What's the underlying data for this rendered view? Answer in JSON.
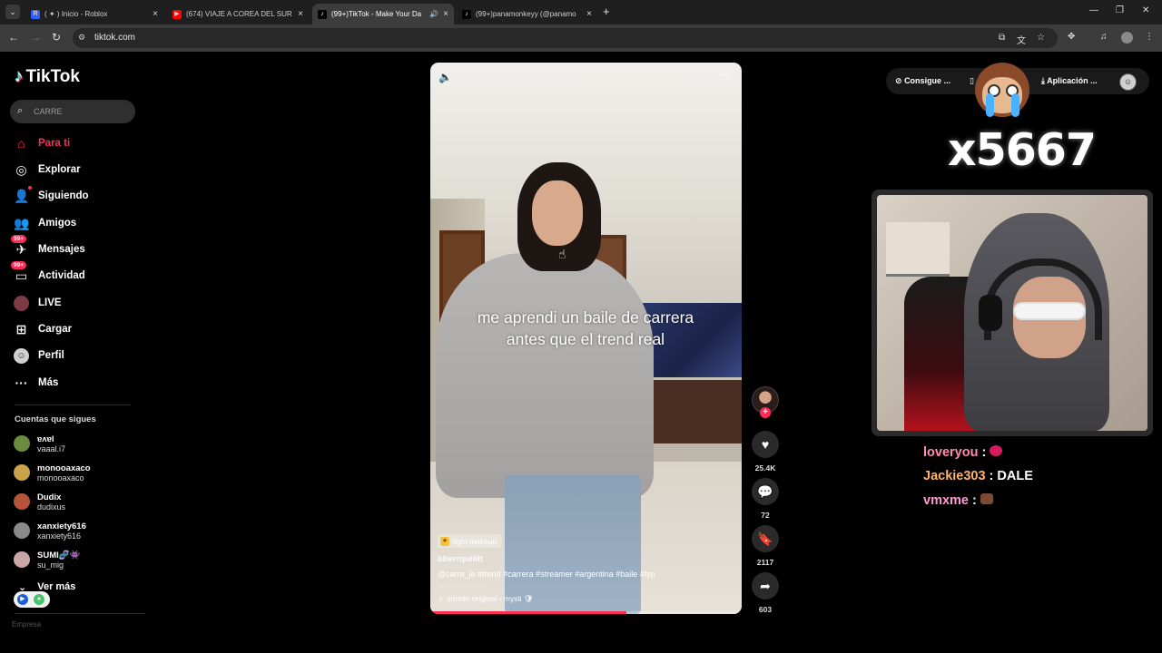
{
  "browser": {
    "tabs": [
      {
        "title": "( ✦ ) Inicio - Roblox",
        "favicon_color": "#335fff",
        "favicon_glyph": "R",
        "active": false
      },
      {
        "title": "(674) VIAJE A COREA DEL SUR (",
        "favicon_color": "#ff0000",
        "favicon_glyph": "▶",
        "active": false
      },
      {
        "title": "(99+)TikTok - Make Your Da",
        "favicon_color": "#000000",
        "favicon_glyph": "♪",
        "active": true,
        "audio": true
      },
      {
        "title": "(99+)panamonkeyy (@panamo",
        "favicon_color": "#000000",
        "favicon_glyph": "♪",
        "active": false
      }
    ],
    "url": "tiktok.com"
  },
  "tiktok": {
    "brand": "TikTok",
    "search_value": "CARRE",
    "nav": [
      {
        "label": "Para ti",
        "icon": "home-icon",
        "active": true
      },
      {
        "label": "Explorar",
        "icon": "compass-icon"
      },
      {
        "label": "Siguiendo",
        "icon": "following-icon"
      },
      {
        "label": "Amigos",
        "icon": "friends-icon"
      },
      {
        "label": "Mensajes",
        "icon": "messages-icon",
        "badge": "99+"
      },
      {
        "label": "Actividad",
        "icon": "activity-icon",
        "badge": "99+"
      },
      {
        "label": "LIVE",
        "icon": "live-icon"
      },
      {
        "label": "Cargar",
        "icon": "upload-icon"
      },
      {
        "label": "Perfil",
        "icon": "profile-icon"
      },
      {
        "label": "Más",
        "icon": "more-icon"
      }
    ],
    "following_title": "Cuentas que sigues",
    "following": [
      {
        "user": "ɐʌɐl",
        "name": "vaaal.i7",
        "color": "#6b8c3e"
      },
      {
        "user": "monooaxaco",
        "name": "monooaxaco",
        "color": "#caa24a"
      },
      {
        "user": "Dudix",
        "name": "dudixus",
        "color": "#b5543b"
      },
      {
        "user": "xanxiety616",
        "name": "xanxiety616",
        "color": "#8a8a8a"
      },
      {
        "user": "SUMI🧬👾",
        "name": "su_mig",
        "color": "#c9a7a7"
      }
    ],
    "see_more": "Ver más",
    "faded_label": "Empresa"
  },
  "video": {
    "caption": "me aprendi un baile de carrera antes que el trend real",
    "tag_pill": "light makeup",
    "author": "bberrquiiitt",
    "description": "@carre_je #trend #carrera #streamer #argentina #baile #fyp",
    "translate": "Ver traducción",
    "sound": "sonido original - mysti 🛡",
    "progress": 0.63,
    "likes": "25.4K",
    "comments": "72",
    "saves": "2117",
    "shares": "603"
  },
  "header_actions": {
    "coins": "Consigue ...",
    "app": "Aplicación ..."
  },
  "stream": {
    "counter": "x5667",
    "chat": [
      {
        "user": "loveryou",
        "sep": " :",
        "user_color": "#ff8ab3",
        "emote_color": "#d81b60"
      },
      {
        "user": "Jackie303",
        "sep": " :",
        "msg": "DALE",
        "user_color": "#ffb36b"
      },
      {
        "user": "vmxme",
        "sep": " :",
        "user_color": "#ff9ad1",
        "emote_color": "#7a4a35"
      }
    ]
  }
}
